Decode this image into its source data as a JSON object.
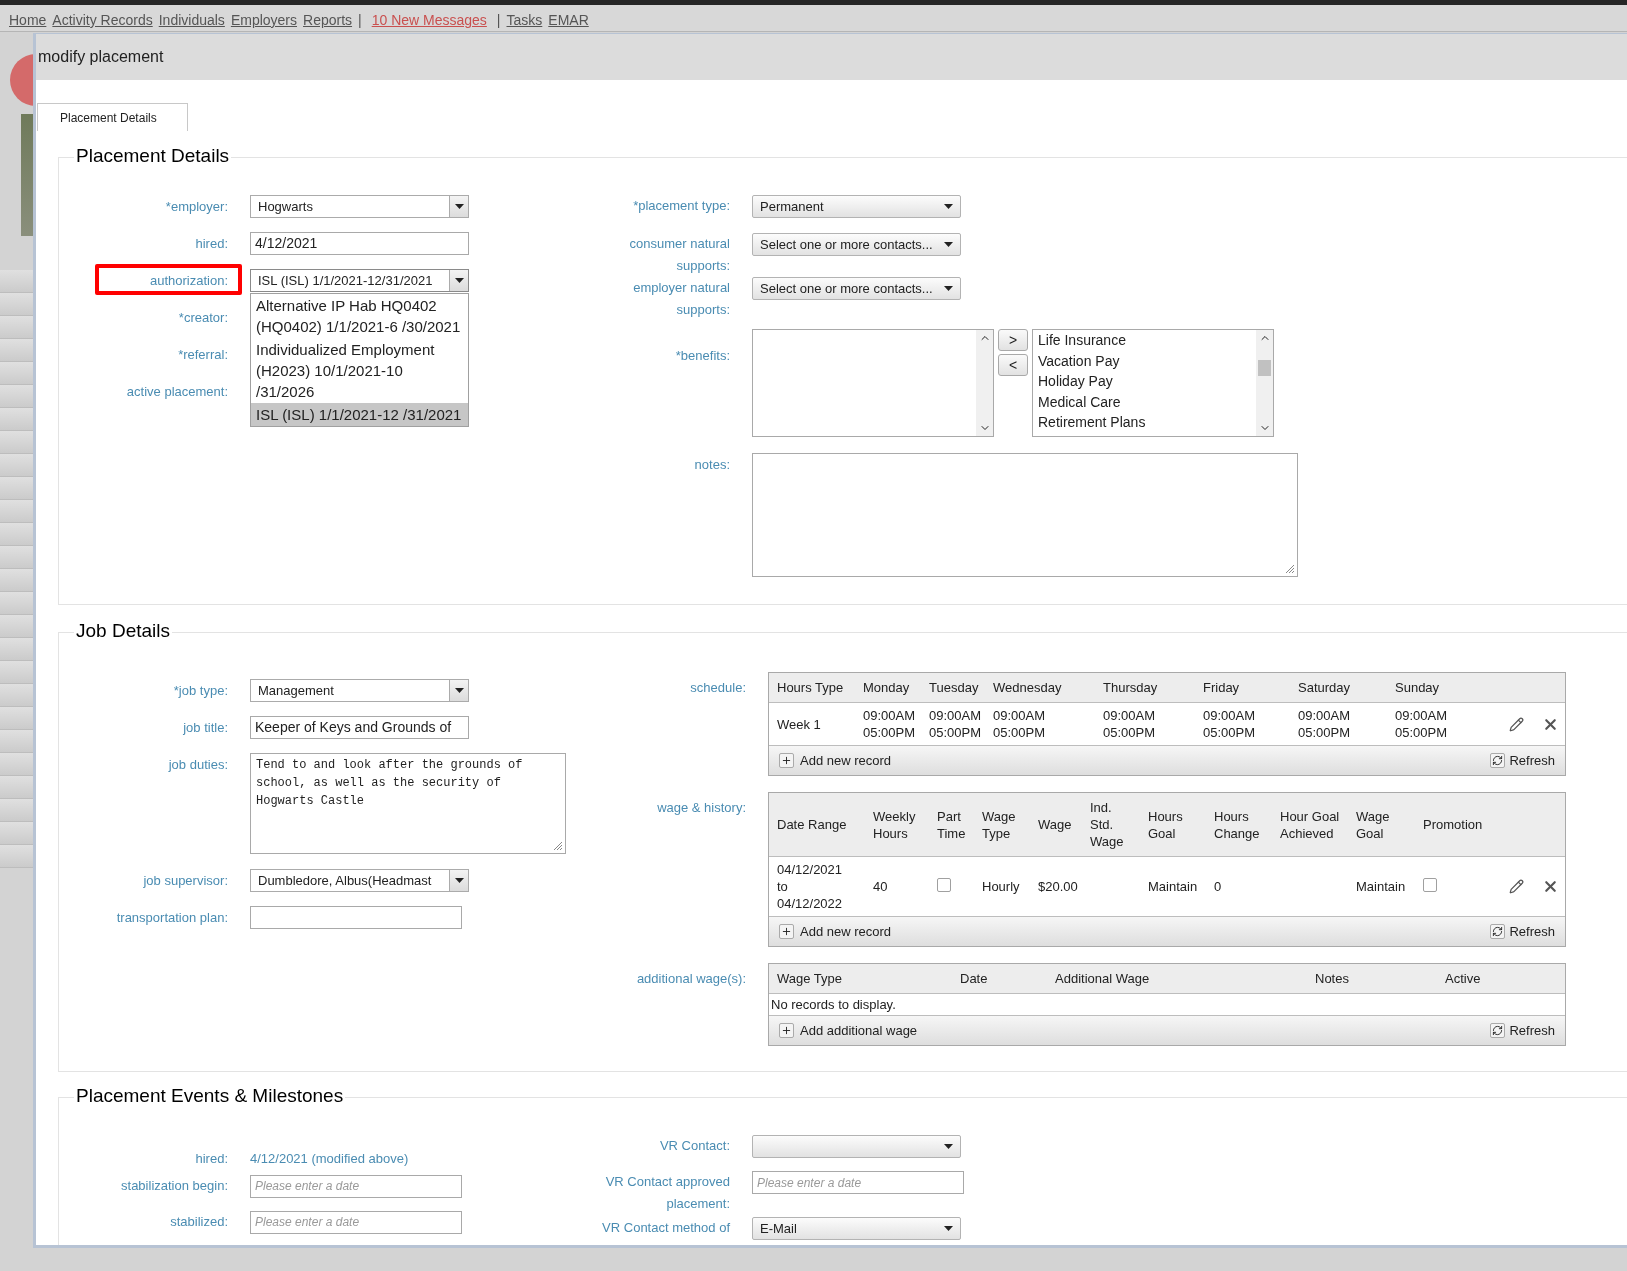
{
  "nav": {
    "items": [
      {
        "kind": "link",
        "text": "Home"
      },
      {
        "kind": "link",
        "text": "Activity Records"
      },
      {
        "kind": "link",
        "text": "Individuals"
      },
      {
        "kind": "link",
        "text": "Employers"
      },
      {
        "kind": "link",
        "text": "Reports"
      },
      {
        "kind": "separator",
        "text": "|"
      },
      {
        "kind": "alert",
        "text": "10 New Messages"
      },
      {
        "kind": "separator",
        "text": "|"
      },
      {
        "kind": "link",
        "text": "Tasks"
      },
      {
        "kind": "link",
        "text": "EMAR"
      }
    ]
  },
  "dialog": {
    "title": "modify placement"
  },
  "tabs": [
    {
      "label": "Placement Details",
      "selected": true
    }
  ],
  "placement_details": {
    "title": "Placement Details",
    "left_fields": [
      {
        "label": "*employer:",
        "kind": "combo",
        "value": "Hogwarts"
      },
      {
        "label": "hired:",
        "kind": "text",
        "value": "4/12/2021"
      },
      {
        "label": "authorization:",
        "kind": "combo",
        "value": "ISL (ISL) 1/1/2021-12/31/2021",
        "highlighted": true,
        "expanded": true,
        "options": [
          {
            "text": "Alternative IP Hab HQ0402 (HQ0402) 1/1/2021-6 /30/2021",
            "selected": false
          },
          {
            "text": "Individualized Employment (H2023) 10/1/2021-10 /31/2026",
            "selected": false
          },
          {
            "text": "ISL (ISL) 1/1/2021-12 /31/2021",
            "selected": true
          }
        ]
      },
      {
        "label": "*creator:",
        "kind": "covered"
      },
      {
        "label": "*referral:",
        "kind": "covered"
      },
      {
        "label": "active placement:",
        "kind": "covered"
      }
    ],
    "right_fields": [
      {
        "label": "*placement type:",
        "kind": "select",
        "value": "Permanent"
      },
      {
        "label": "consumer natural supports:",
        "kind": "select",
        "value": "Select one or more contacts..."
      },
      {
        "label": "employer natural supports:",
        "kind": "select",
        "value": "Select one or more contacts..."
      },
      {
        "label": "*benefits:",
        "kind": "transfer",
        "buttons": [
          ">",
          "<"
        ],
        "chosen": [
          "Life Insurance",
          "Vacation Pay",
          "Holiday Pay",
          "Medical Care",
          "Retirement Plans"
        ]
      },
      {
        "label": "notes:",
        "kind": "textarea"
      }
    ]
  },
  "job_details": {
    "title": "Job Details",
    "left_fields": [
      {
        "label": "*job type:",
        "kind": "combo",
        "value": "Management"
      },
      {
        "label": "job title:",
        "kind": "text",
        "value": "Keeper of Keys and Grounds of"
      },
      {
        "label": "job duties:",
        "kind": "textarea",
        "value": "Tend to and look after the grounds of school, as well as the security of Hogwarts Castle"
      },
      {
        "label": "job supervisor:",
        "kind": "combo",
        "value": "Dumbledore, Albus(Headmast"
      },
      {
        "label": "transportation plan:",
        "kind": "text"
      }
    ],
    "grids": [
      {
        "label": "schedule:",
        "columns": [
          "Hours Type",
          "Monday",
          "Tuesday",
          "Wednesday",
          "Thursday",
          "Friday",
          "Saturday",
          "Sunday"
        ],
        "rows": [
          {
            "editable": true,
            "cells": [
              {
                "kind": "text",
                "text": "Week 1"
              },
              {
                "kind": "stacked",
                "text": "09:00AM 05:00PM"
              },
              {
                "kind": "stacked",
                "text": "09:00AM 05:00PM"
              },
              {
                "kind": "stacked",
                "text": "09:00AM 05:00PM"
              },
              {
                "kind": "stacked",
                "text": "09:00AM 05:00PM"
              },
              {
                "kind": "stacked",
                "text": "09:00AM 05:00PM"
              },
              {
                "kind": "stacked",
                "text": "09:00AM 05:00PM"
              },
              {
                "kind": "stacked",
                "text": "09:00AM 05:00PM"
              }
            ]
          }
        ],
        "add_label": "Add new record",
        "refresh_label": "Refresh"
      },
      {
        "label": "wage & history:",
        "columns": [
          "Date Range",
          "Weekly Hours",
          "Part Time",
          "Wage Type",
          "Wage",
          "Ind. Std. Wage",
          "Hours Goal",
          "Hours Change",
          "Hour Goal Achieved",
          "Wage Goal",
          "Promotion"
        ],
        "rows": [
          {
            "editable": true,
            "cells": [
              {
                "kind": "stacked",
                "text": "04/12/2021 to 04/12/2022"
              },
              {
                "kind": "text",
                "text": "40"
              },
              {
                "kind": "checkbox",
                "checked": false
              },
              {
                "kind": "text",
                "text": "Hourly"
              },
              {
                "kind": "text",
                "text": "$20.00"
              },
              {
                "kind": "empty"
              },
              {
                "kind": "text",
                "text": "Maintain"
              },
              {
                "kind": "text",
                "text": "0"
              },
              {
                "kind": "empty"
              },
              {
                "kind": "text",
                "text": "Maintain"
              },
              {
                "kind": "checkbox",
                "checked": false
              }
            ]
          }
        ],
        "add_label": "Add new record",
        "refresh_label": "Refresh"
      },
      {
        "label": "additional wage(s):",
        "columns": [
          "Wage Type",
          "Date",
          "Additional Wage",
          "Notes",
          "Active"
        ],
        "empty_text": "No records to display.",
        "add_label": "Add additional wage",
        "refresh_label": "Refresh"
      }
    ]
  },
  "events": {
    "title": "Placement Events & Milestones",
    "left_fields": [
      {
        "label": "hired:",
        "kind": "static",
        "value": "4/12/2021 (modified above)"
      },
      {
        "label": "stabilization begin:",
        "kind": "date",
        "placeholder": "Please enter a date"
      },
      {
        "label": "stabilized:",
        "kind": "date",
        "placeholder": "Please enter a date"
      }
    ],
    "right_fields": [
      {
        "label": "VR Contact:",
        "kind": "select"
      },
      {
        "label": "VR Contact approved placement:",
        "kind": "date",
        "placeholder": "Please enter a date"
      },
      {
        "label": "VR Contact method of",
        "kind": "select",
        "value": "E-Mail"
      }
    ]
  }
}
